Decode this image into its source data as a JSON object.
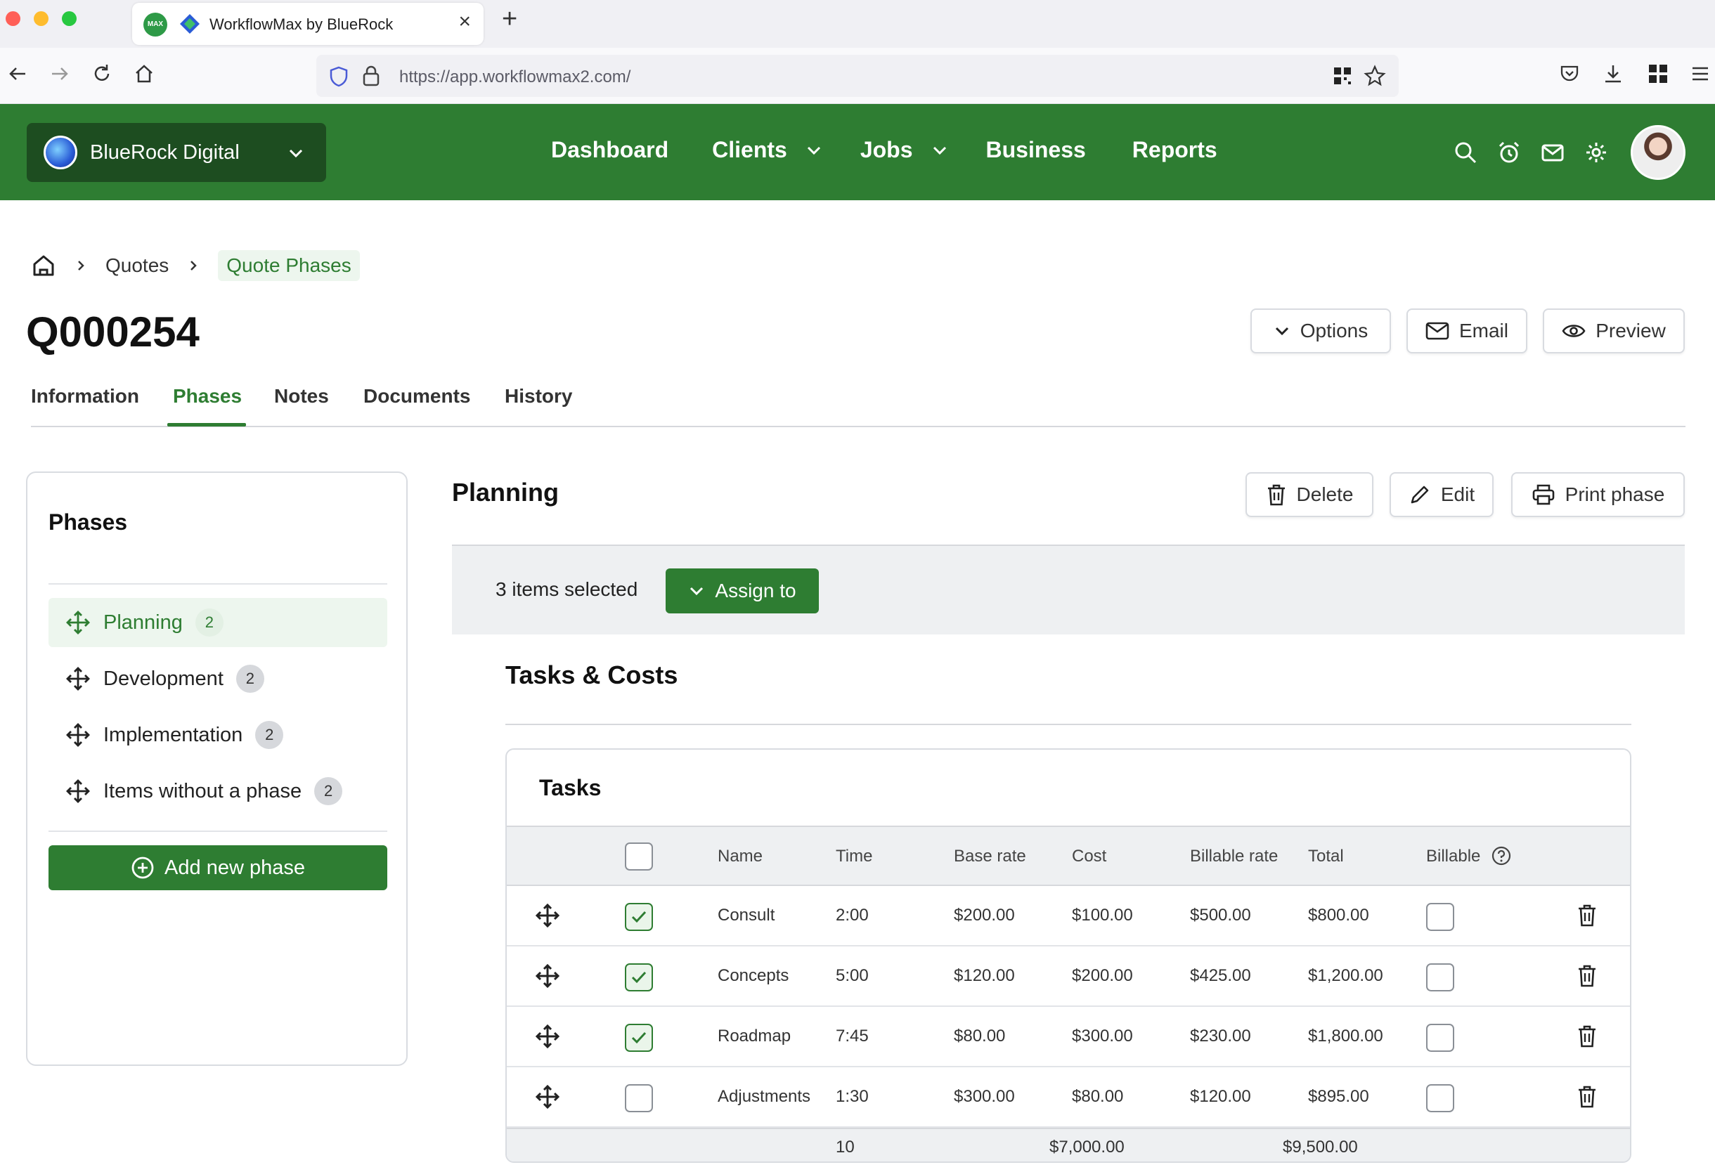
{
  "browser": {
    "tab_title": "WorkflowMax by BlueRock",
    "url": "https://app.workflowmax2.com/"
  },
  "header": {
    "org_name": "BlueRock Digital",
    "nav": [
      "Dashboard",
      "Clients",
      "Jobs",
      "Business",
      "Reports"
    ]
  },
  "breadcrumb": {
    "items": [
      "Quotes"
    ],
    "current": "Quote Phases"
  },
  "page": {
    "title": "Q000254",
    "actions": {
      "options": "Options",
      "email": "Email",
      "preview": "Preview"
    },
    "tabs": [
      "Information",
      "Phases",
      "Notes",
      "Documents",
      "History"
    ],
    "active_tab": "Phases"
  },
  "phases": {
    "title": "Phases",
    "items": [
      {
        "name": "Planning",
        "count": "2"
      },
      {
        "name": "Development",
        "count": "2"
      },
      {
        "name": "Implementation",
        "count": "2"
      },
      {
        "name": "Items without a phase",
        "count": "2"
      }
    ],
    "add_label": "Add new phase"
  },
  "phase_detail": {
    "title": "Planning",
    "actions": {
      "delete": "Delete",
      "edit": "Edit",
      "print": "Print phase"
    },
    "selection_text": "3 items selected",
    "assign_label": "Assign to",
    "section_title": "Tasks & Costs"
  },
  "tasks": {
    "title": "Tasks",
    "columns": [
      "Name",
      "Time",
      "Base rate",
      "Cost",
      "Billable rate",
      "Total",
      "Billable"
    ],
    "rows": [
      {
        "name": "Consult",
        "time": "2:00",
        "base_rate": "$200.00",
        "cost": "$100.00",
        "billable_rate": "$500.00",
        "total": "$800.00",
        "selected": true,
        "billable": false
      },
      {
        "name": "Concepts",
        "time": "5:00",
        "base_rate": "$120.00",
        "cost": "$200.00",
        "billable_rate": "$425.00",
        "total": "$1,200.00",
        "selected": true,
        "billable": false
      },
      {
        "name": "Roadmap",
        "time": "7:45",
        "base_rate": "$80.00",
        "cost": "$300.00",
        "billable_rate": "$230.00",
        "total": "$1,800.00",
        "selected": true,
        "billable": false
      },
      {
        "name": "Adjustments",
        "time": "1:30",
        "base_rate": "$300.00",
        "cost": "$80.00",
        "billable_rate": "$120.00",
        "total": "$895.00",
        "selected": false,
        "billable": false
      }
    ],
    "totals": {
      "time": "10",
      "cost": "$7,000.00",
      "total": "$9,500.00"
    }
  },
  "colors": {
    "brand_green": "#2e7d32",
    "org_switch_bg": "#1d4d20",
    "active_phase_bg": "#edf6ee"
  },
  "icons": [
    "home-icon",
    "search-icon",
    "alarm-icon",
    "mail-icon",
    "gear-icon",
    "move-icon",
    "trash-icon",
    "pencil-icon",
    "printer-icon",
    "eye-icon",
    "chevron-down-icon",
    "plus-circle-icon",
    "help-icon"
  ]
}
